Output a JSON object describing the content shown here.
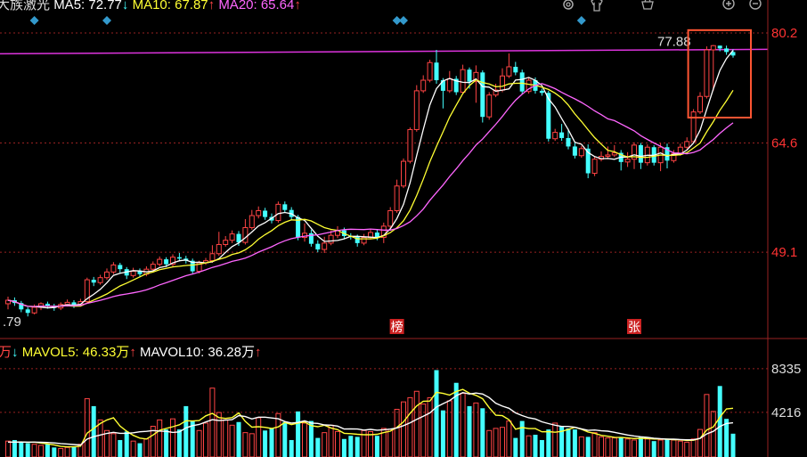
{
  "header": {
    "stock_name": "大族激光",
    "ma5_label": "MA5: 72.77",
    "ma10_label": "MA10: 67.87",
    "ma20_label": "MA20: 65.64",
    "up_arrow": "↑",
    "down_arrow": "↓"
  },
  "volume_header": {
    "vol_unit_fragment": "万",
    "mavol5_label": "MAVOL5: 46.33万",
    "mavol10_label": "MAVOL10: 36.28万"
  },
  "toolbar_icons": [
    "gear-icon",
    "shirt-icon",
    "basket-icon",
    "zoom-in-icon",
    "zoom-out-icon"
  ],
  "colors": {
    "up": "#ff4444",
    "down": "#44ffff",
    "ma5": "#ffffff",
    "ma10": "#ffff33",
    "ma20": "#ff66ff",
    "ref_line": "#dd33dd",
    "grid": "#992222",
    "price_axis": "#ff3333",
    "highlight_box": "#ff5533",
    "marker": "#3399cc"
  },
  "chart_data": [
    {
      "type": "candlestick",
      "price_axis_labels": [
        "80.2",
        "64.6",
        "49.1"
      ],
      "ylim": [
        37.5,
        82.6
      ],
      "reference_line_value": 77.88,
      "reference_line_label": "77.88",
      "low_label": ".79",
      "annotations": [
        {
          "text": "榜",
          "index": 59
        },
        {
          "text": "张",
          "index": 95
        }
      ],
      "marker_indices": [
        4,
        15,
        59,
        60,
        87
      ],
      "candles": [
        [
          41.8,
          42.3,
          41.0,
          42.8
        ],
        [
          42.3,
          41.9,
          41.5,
          42.7
        ],
        [
          41.9,
          41.0,
          40.6,
          42.2
        ],
        [
          41.0,
          40.5,
          40.0,
          41.3
        ],
        [
          40.5,
          41.3,
          40.3,
          41.7
        ],
        [
          41.3,
          41.8,
          40.9,
          42.0
        ],
        [
          41.8,
          41.5,
          41.1,
          42.1
        ],
        [
          41.5,
          41.2,
          40.8,
          41.8
        ],
        [
          41.2,
          41.7,
          40.9,
          42.0
        ],
        [
          41.7,
          42.0,
          41.4,
          42.4
        ],
        [
          42.0,
          41.6,
          41.2,
          42.3
        ],
        [
          41.6,
          42.1,
          41.4,
          42.5
        ],
        [
          42.1,
          45.2,
          42.0,
          45.5
        ],
        [
          45.2,
          44.8,
          44.3,
          45.6
        ],
        [
          44.8,
          45.5,
          44.5,
          45.9
        ],
        [
          45.5,
          46.3,
          45.2,
          46.8
        ],
        [
          46.3,
          47.3,
          46.0,
          47.7
        ],
        [
          47.3,
          46.7,
          46.2,
          47.6
        ],
        [
          46.7,
          45.8,
          45.3,
          47.0
        ],
        [
          45.8,
          46.4,
          45.5,
          46.9
        ],
        [
          46.4,
          46.0,
          45.6,
          46.8
        ],
        [
          46.0,
          46.7,
          45.7,
          47.1
        ],
        [
          46.7,
          47.4,
          46.4,
          47.8
        ],
        [
          47.4,
          48.1,
          47.1,
          48.5
        ],
        [
          48.1,
          47.4,
          47.0,
          48.4
        ],
        [
          47.4,
          48.4,
          47.1,
          48.8
        ],
        [
          48.4,
          48.2,
          47.8,
          49.0
        ],
        [
          48.2,
          47.9,
          47.5,
          48.6
        ],
        [
          47.9,
          46.4,
          46.1,
          48.2
        ],
        [
          46.4,
          47.6,
          46.1,
          47.9
        ],
        [
          47.6,
          47.9,
          47.3,
          48.3
        ],
        [
          47.9,
          48.9,
          47.6,
          50.1
        ],
        [
          48.9,
          50.2,
          48.6,
          52.0
        ],
        [
          50.2,
          50.8,
          49.9,
          51.4
        ],
        [
          50.8,
          51.7,
          50.4,
          52.2
        ],
        [
          51.7,
          50.5,
          50.0,
          52.1
        ],
        [
          50.5,
          52.6,
          50.2,
          53.8
        ],
        [
          52.6,
          54.3,
          52.3,
          55.1
        ],
        [
          54.3,
          55.0,
          53.9,
          55.6
        ],
        [
          55.0,
          54.1,
          53.7,
          55.4
        ],
        [
          54.1,
          53.6,
          53.2,
          54.6
        ],
        [
          53.6,
          55.9,
          53.3,
          56.3
        ],
        [
          55.9,
          55.1,
          54.7,
          56.3
        ],
        [
          55.1,
          54.1,
          53.6,
          55.5
        ],
        [
          54.1,
          51.2,
          50.8,
          54.4
        ],
        [
          51.2,
          51.8,
          50.6,
          53.2
        ],
        [
          51.8,
          50.3,
          49.9,
          52.3
        ],
        [
          50.3,
          49.5,
          49.1,
          50.8
        ],
        [
          49.5,
          50.4,
          49.0,
          51.3
        ],
        [
          50.4,
          51.5,
          50.1,
          52.2
        ],
        [
          51.5,
          52.2,
          51.1,
          52.8
        ],
        [
          52.2,
          51.4,
          51.0,
          52.6
        ],
        [
          51.4,
          51.3,
          50.9,
          51.8
        ],
        [
          51.3,
          50.4,
          49.9,
          51.6
        ],
        [
          50.4,
          51.2,
          50.1,
          51.7
        ],
        [
          51.2,
          51.9,
          50.9,
          52.4
        ],
        [
          51.9,
          51.2,
          50.8,
          52.3
        ],
        [
          51.2,
          52.8,
          50.4,
          53.3
        ],
        [
          52.8,
          55.0,
          52.5,
          55.5
        ],
        [
          55.0,
          58.5,
          54.7,
          59.4
        ],
        [
          58.5,
          62.0,
          58.2,
          62.4
        ],
        [
          62.0,
          66.5,
          61.7,
          66.8
        ],
        [
          66.5,
          72.0,
          66.2,
          72.8
        ],
        [
          72.0,
          73.5,
          71.7,
          74.2
        ],
        [
          73.5,
          76.0,
          73.2,
          76.4
        ],
        [
          76.0,
          73.5,
          73.0,
          77.8
        ],
        [
          73.5,
          72.0,
          69.5,
          73.8
        ],
        [
          72.0,
          73.7,
          71.7,
          74.8
        ],
        [
          73.7,
          71.8,
          71.4,
          74.1
        ],
        [
          71.8,
          75.0,
          71.5,
          75.7
        ],
        [
          75.0,
          73.3,
          72.3,
          75.3
        ],
        [
          73.3,
          74.6,
          70.3,
          75.6
        ],
        [
          74.6,
          68.3,
          67.5,
          74.9
        ],
        [
          68.3,
          71.4,
          67.9,
          71.8
        ],
        [
          71.4,
          72.1,
          71.1,
          73.0
        ],
        [
          72.1,
          74.1,
          71.8,
          75.2
        ],
        [
          74.1,
          75.4,
          73.8,
          77.3
        ],
        [
          75.4,
          74.6,
          74.2,
          76.1
        ],
        [
          74.6,
          71.9,
          71.5,
          75.0
        ],
        [
          71.9,
          73.5,
          71.6,
          73.9
        ],
        [
          73.5,
          72.0,
          71.6,
          73.9
        ],
        [
          72.0,
          71.7,
          71.3,
          72.3
        ],
        [
          71.7,
          65.2,
          64.8,
          72.0
        ],
        [
          65.2,
          66.1,
          64.9,
          66.6
        ],
        [
          66.1,
          65.3,
          64.9,
          67.3
        ],
        [
          65.3,
          64.1,
          63.7,
          66.6
        ],
        [
          64.1,
          62.8,
          62.4,
          64.7
        ],
        [
          62.8,
          63.8,
          62.5,
          64.2
        ],
        [
          63.8,
          60.3,
          59.6,
          64.4
        ],
        [
          60.3,
          62.3,
          59.9,
          62.6
        ],
        [
          62.3,
          62.7,
          62.0,
          63.4
        ],
        [
          62.7,
          62.9,
          62.3,
          64.1
        ],
        [
          62.9,
          63.2,
          62.6,
          64.3
        ],
        [
          63.2,
          61.9,
          60.7,
          63.6
        ],
        [
          61.9,
          62.3,
          61.2,
          63.3
        ],
        [
          62.3,
          64.3,
          60.9,
          64.7
        ],
        [
          64.3,
          61.8,
          60.9,
          64.6
        ],
        [
          61.8,
          64.0,
          61.4,
          64.4
        ],
        [
          64.0,
          61.8,
          61.4,
          64.3
        ],
        [
          61.8,
          64.0,
          60.6,
          64.6
        ],
        [
          64.0,
          62.1,
          61.0,
          64.5
        ],
        [
          62.1,
          63.1,
          61.8,
          63.6
        ],
        [
          63.1,
          64.0,
          62.8,
          64.5
        ],
        [
          64.0,
          64.8,
          63.7,
          65.4
        ],
        [
          64.8,
          69.0,
          64.5,
          69.4
        ],
        [
          69.0,
          71.2,
          68.7,
          71.8
        ],
        [
          71.2,
          77.8,
          70.9,
          78.3
        ],
        [
          77.8,
          78.4,
          72.0,
          78.5
        ],
        [
          78.4,
          78.0,
          77.6,
          78.4
        ],
        [
          78.0,
          77.5,
          77.1,
          78.4
        ],
        [
          77.5,
          77.0,
          76.7,
          77.9
        ]
      ]
    },
    {
      "type": "bar",
      "title": "volume",
      "axis_labels": [
        "8335",
        "4216"
      ],
      "ylim": [
        0,
        9500
      ],
      "values": [
        1500,
        1600,
        1400,
        1300,
        1200,
        1100,
        1200,
        900,
        800,
        900,
        1000,
        1200,
        5500,
        4800,
        3500,
        2500,
        2200,
        1600,
        2400,
        1500,
        1300,
        1700,
        2900,
        3500,
        2600,
        3600,
        2600,
        4800,
        3400,
        2500,
        3200,
        6500,
        4200,
        3500,
        3000,
        3300,
        2300,
        2200,
        3700,
        2500,
        2700,
        4100,
        3300,
        1600,
        4300,
        3200,
        3400,
        1800,
        2300,
        3000,
        2400,
        1700,
        2000,
        1900,
        2500,
        2400,
        2000,
        2700,
        2600,
        4500,
        5200,
        5600,
        6200,
        5000,
        5600,
        8200,
        4400,
        5300,
        7000,
        6000,
        4800,
        5100,
        4600,
        2500,
        2700,
        2800,
        3400,
        1800,
        3400,
        2000,
        2100,
        1600,
        2600,
        3200,
        2900,
        2700,
        2600,
        1900,
        1900,
        2300,
        1900,
        1800,
        1800,
        1900,
        1700,
        1600,
        1900,
        1700,
        1500,
        1600,
        1700,
        1600,
        1500,
        1400,
        1700,
        2600,
        5900,
        4300,
        6700,
        3600,
        2200
      ],
      "series": [
        {
          "name": "MAVOL5",
          "values": [
            1400,
            1400,
            1420,
            1380,
            1400,
            1320,
            1240,
            1140,
            1000,
            960,
            960,
            1020,
            2250,
            2700,
            3160,
            3500,
            3700,
            2920,
            2440,
            2040,
            1780,
            1700,
            2080,
            2520,
            2700,
            2860,
            3040,
            3420,
            3400,
            3440,
            3880,
            4120,
            3720,
            3640,
            3720,
            4160,
            3360,
            2820,
            2860,
            2800,
            2690,
            2840,
            3260,
            3060,
            3200,
            3300,
            2960,
            2860,
            3000,
            2740,
            2580,
            2240,
            2200,
            2140,
            2100,
            2100,
            2140,
            2300,
            2440,
            2800,
            3320,
            4120,
            4820,
            5260,
            5280,
            6100,
            6000,
            5840,
            6180,
            6380,
            6020,
            5820,
            5500,
            4660,
            3940,
            3900,
            3520,
            2620,
            2780,
            2680,
            2680,
            2380,
            2400,
            2340,
            2420,
            2600,
            2800,
            2620,
            2360,
            2240,
            2040,
            1960,
            1860,
            1840,
            1800,
            1740,
            1760,
            1740,
            1700,
            1700,
            1680,
            1640,
            1620,
            1560,
            1580,
            1760,
            2550,
            2840,
            3760,
            4540,
            4600
          ]
        },
        {
          "name": "MAVOL10",
          "values": [
            1400,
            1400,
            1410,
            1400,
            1400,
            1390,
            1370,
            1330,
            1270,
            1230,
            1180,
            1130,
            1690,
            1920,
            2080,
            2230,
            2330,
            2240,
            2240,
            2290,
            2380,
            2420,
            2500,
            2450,
            2420,
            2320,
            2370,
            2750,
            2960,
            3070,
            3300,
            3520,
            3440,
            3480,
            3520,
            3910,
            3820,
            3590,
            3760,
            3760,
            3680,
            3610,
            3350,
            3200,
            3260,
            3410,
            3200,
            3170,
            3030,
            3000,
            2920,
            2640,
            2650,
            2640,
            2540,
            2610,
            2530,
            2570,
            2630,
            2740,
            2960,
            3230,
            3560,
            3840,
            4160,
            4720,
            5040,
            5320,
            5780,
            6080,
            5940,
            6040,
            5940,
            5610,
            5080,
            4800,
            4600,
            4160,
            3910,
            3700,
            3590,
            3320,
            3150,
            3000,
            2880,
            2880,
            2810,
            2660,
            2510,
            2550,
            2470,
            2440,
            2330,
            2200,
            2080,
            1980,
            1910,
            1850,
            1770,
            1720,
            1690,
            1680,
            1650,
            1620,
            1620,
            1760,
            2180,
            2420,
            2880,
            3160,
            3230
          ]
        }
      ]
    }
  ]
}
